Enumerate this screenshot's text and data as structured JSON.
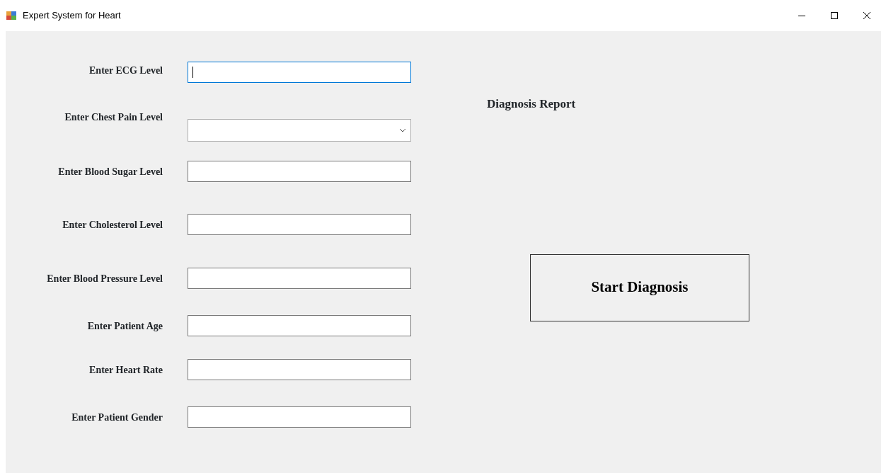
{
  "window": {
    "title": "Expert System for Heart"
  },
  "fields": [
    {
      "label": "Enter ECG Level",
      "kind": "text",
      "focused": true
    },
    {
      "label": "Enter Chest Pain Level",
      "kind": "combo",
      "focused": false
    },
    {
      "label": "Enter Blood Sugar Level",
      "kind": "text",
      "focused": false
    },
    {
      "label": "Enter Cholesterol Level",
      "kind": "text",
      "focused": false
    },
    {
      "label": "Enter Blood Pressure Level",
      "kind": "text",
      "focused": false
    },
    {
      "label": "Enter Patient Age",
      "kind": "text",
      "focused": false
    },
    {
      "label": "Enter Heart Rate",
      "kind": "text",
      "focused": false
    },
    {
      "label": "Enter Patient Gender",
      "kind": "text",
      "focused": false
    }
  ],
  "report": {
    "title": "Diagnosis Report"
  },
  "button": "Start Diagnosis"
}
